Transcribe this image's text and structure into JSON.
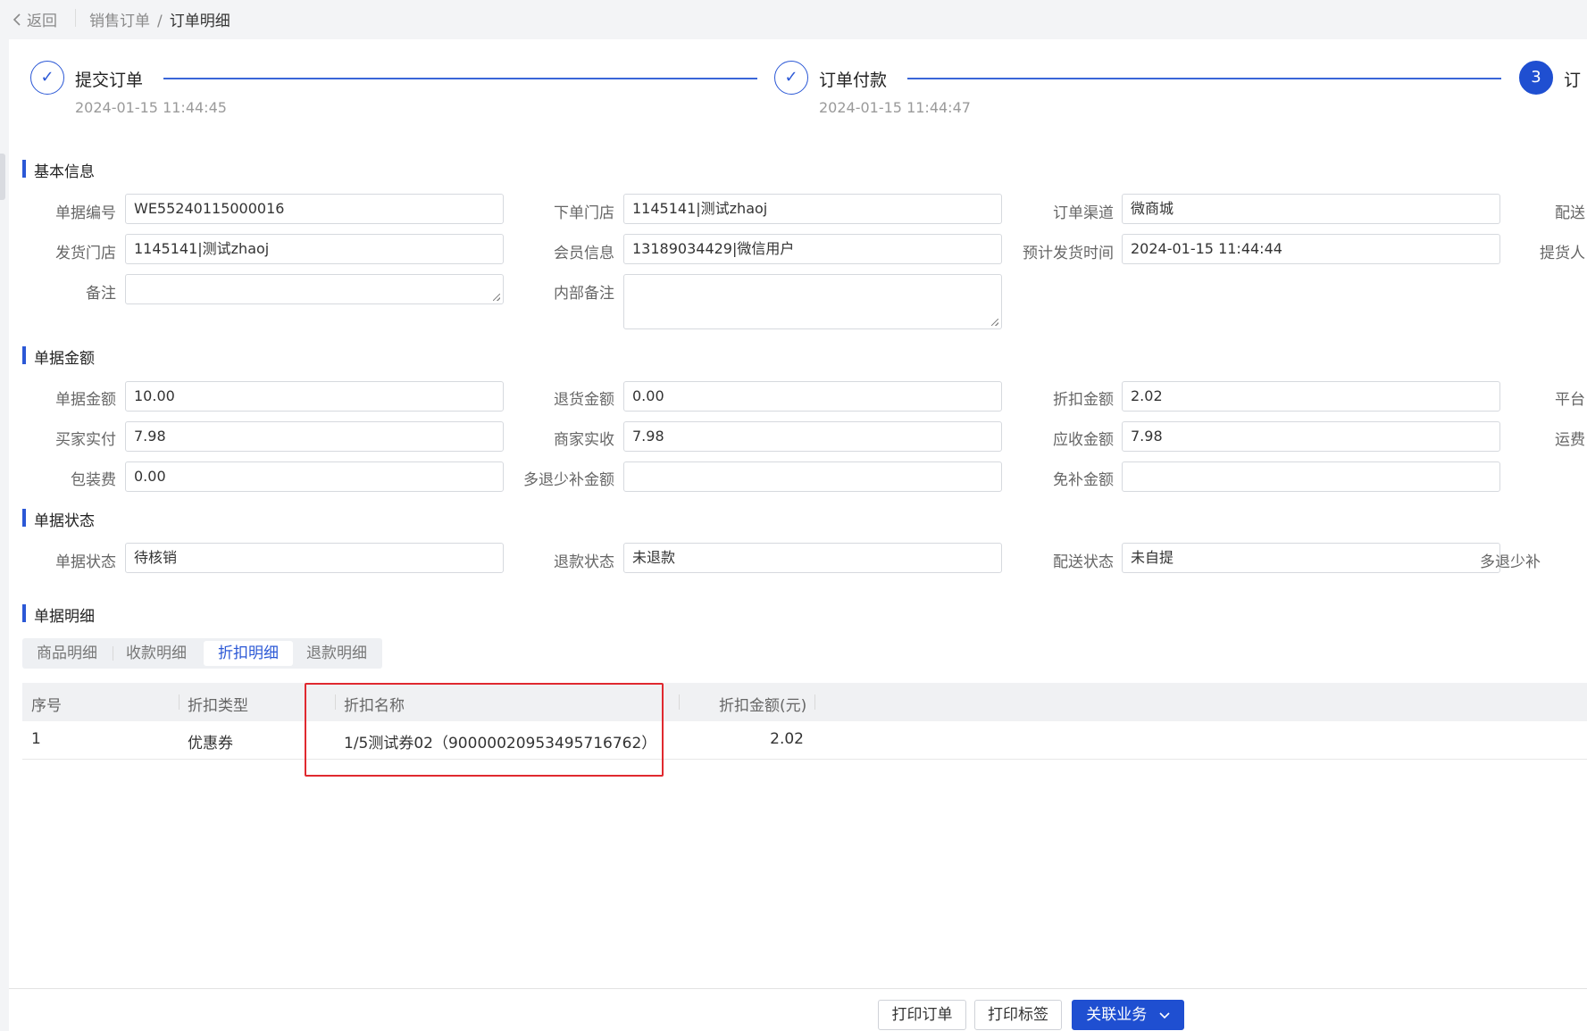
{
  "topbar": {
    "back_label": "返回",
    "breadcrumb": [
      "销售订单",
      "订单明细"
    ],
    "breadcrumb_sep": "/"
  },
  "steps": [
    {
      "icon": "✓",
      "title": "提交订单",
      "time": "2024-01-15 11:44:45"
    },
    {
      "icon": "✓",
      "title": "订单付款",
      "time": "2024-01-15 11:44:47"
    },
    {
      "icon": "3",
      "title": "订"
    }
  ],
  "sections": {
    "basic": "基本信息",
    "amount": "单据金额",
    "status": "单据状态",
    "detail": "单据明细"
  },
  "basic": {
    "doc_no": {
      "label": "单据编号",
      "value": "WE55240115000016"
    },
    "order_store": {
      "label": "下单门店",
      "value": "1145141|测试zhaoj"
    },
    "channel": {
      "label": "订单渠道",
      "value": "微商城"
    },
    "delivery_cut": {
      "label": "配送"
    },
    "ship_store": {
      "label": "发货门店",
      "value": "1145141|测试zhaoj"
    },
    "member": {
      "label": "会员信息",
      "value": "13189034429|微信用户"
    },
    "est_ship_time": {
      "label": "预计发货时间",
      "value": "2024-01-15 11:44:44"
    },
    "pickup_cut": {
      "label": "提货人"
    },
    "remark": {
      "label": "备注",
      "value": ""
    },
    "internal_remark": {
      "label": "内部备注",
      "value": ""
    }
  },
  "amount": {
    "doc_amount": {
      "label": "单据金额",
      "value": "10.00"
    },
    "return_amount": {
      "label": "退货金额",
      "value": "0.00"
    },
    "discount_amount": {
      "label": "折扣金额",
      "value": "2.02"
    },
    "platform_cut": {
      "label": "平台"
    },
    "buyer_paid": {
      "label": "买家实付",
      "value": "7.98"
    },
    "merchant_received": {
      "label": "商家实收",
      "value": "7.98"
    },
    "receivable": {
      "label": "应收金额",
      "value": "7.98"
    },
    "freight_cut": {
      "label": "运费"
    },
    "packing_fee": {
      "label": "包装费",
      "value": "0.00"
    },
    "over_refund": {
      "label": "多退少补金额",
      "value": ""
    },
    "exempt_amount": {
      "label": "免补金额",
      "value": ""
    }
  },
  "status": {
    "doc_status": {
      "label": "单据状态",
      "value": "待核销"
    },
    "refund_status": {
      "label": "退款状态",
      "value": "未退款"
    },
    "delivery_status": {
      "label": "配送状态",
      "value": "未自提"
    },
    "over_refund_cut": {
      "label": "多退少补"
    }
  },
  "detail_tabs": [
    {
      "label": "商品明细",
      "active": false
    },
    {
      "label": "收款明细",
      "active": false
    },
    {
      "label": "折扣明细",
      "active": true
    },
    {
      "label": "退款明细",
      "active": false
    }
  ],
  "table": {
    "columns": [
      "序号",
      "折扣类型",
      "折扣名称",
      "折扣金额(元)"
    ],
    "rows": [
      {
        "index": "1",
        "type": "优惠券",
        "name": "1/5测试券02（900000209534957167​62）",
        "amount": "2.02"
      }
    ]
  },
  "footer": {
    "print_order": "打印订单",
    "print_label": "打印标签",
    "related": "关联业务",
    "related_icon": "chevron-down-icon"
  },
  "colors": {
    "primary": "#1f4fd1",
    "highlight": "#e0292f"
  }
}
